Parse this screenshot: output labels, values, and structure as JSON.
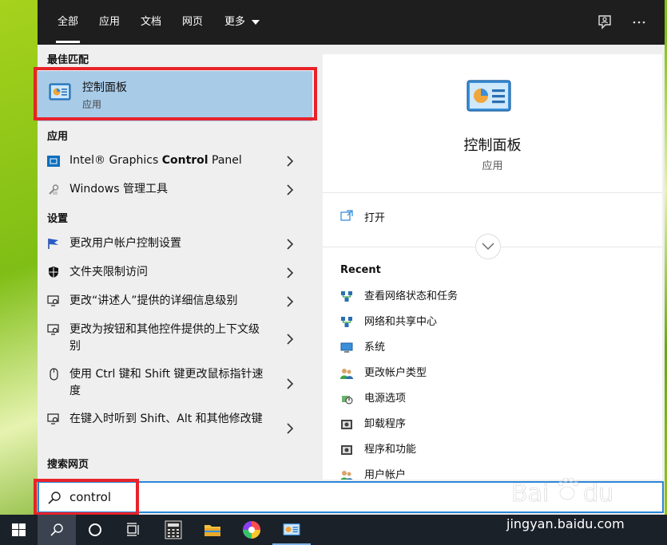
{
  "tabs": [
    {
      "label": "全部",
      "active": true
    },
    {
      "label": "应用",
      "active": false
    },
    {
      "label": "文档",
      "active": false
    },
    {
      "label": "网页",
      "active": false
    },
    {
      "label": "更多",
      "active": false
    }
  ],
  "top_icons": [
    "feedback-icon",
    "more-icon"
  ],
  "left": {
    "best_match_heading": "最佳匹配",
    "best_match": {
      "title": "控制面板",
      "subtitle": "应用"
    },
    "apps_heading": "应用",
    "apps": [
      {
        "prefix": "Intel® Graphics ",
        "bold": "Control",
        "suffix": " Panel"
      },
      {
        "label": "Windows 管理工具"
      }
    ],
    "settings_heading": "设置",
    "settings": [
      {
        "label": "更改用户帐户控制设置"
      },
      {
        "label": "文件夹限制访问"
      },
      {
        "label": "更改“讲述人”提供的详细信息级别"
      },
      {
        "label": "更改为按钮和其他控件提供的上下文级别"
      },
      {
        "label": "使用 Ctrl 键和 Shift 键更改鼠标指针速度"
      },
      {
        "label": "在键入时听到 Shift、Alt 和其他修改键"
      }
    ],
    "web_heading": "搜索网页"
  },
  "right": {
    "title": "控制面板",
    "subtitle": "应用",
    "open_label": "打开",
    "recent_heading": "Recent",
    "recent": [
      {
        "label": "查看网络状态和任务",
        "icon": "network-icon"
      },
      {
        "label": "网络和共享中心",
        "icon": "network-icon"
      },
      {
        "label": "系统",
        "icon": "system-icon"
      },
      {
        "label": "更改帐户类型",
        "icon": "users-icon"
      },
      {
        "label": "电源选项",
        "icon": "power-icon"
      },
      {
        "label": "卸载程序",
        "icon": "programs-icon"
      },
      {
        "label": "程序和功能",
        "icon": "programs-icon"
      },
      {
        "label": "用户帐户",
        "icon": "users-icon"
      }
    ]
  },
  "search": {
    "value": "control"
  },
  "taskbar": [
    "windows-start",
    "search",
    "cortana",
    "task-view",
    "calculator",
    "file-explorer",
    "photos",
    "control-panel"
  ],
  "watermark": {
    "url": "jingyan.baidu.com",
    "logo": "Baidu经验"
  },
  "colors": {
    "accent": "#2a86d8",
    "highlight": "#a8cbe8",
    "red_box": "#e8222a"
  }
}
